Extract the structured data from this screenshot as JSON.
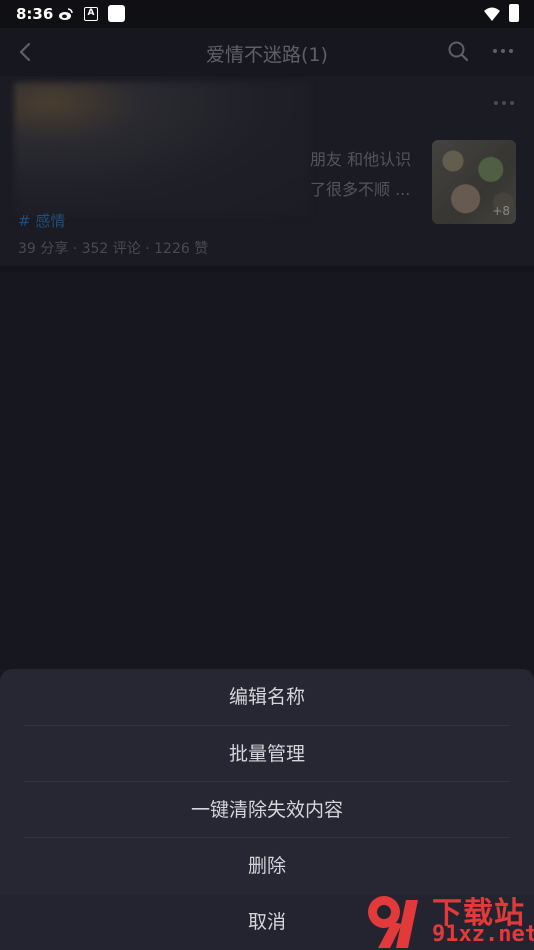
{
  "status_bar": {
    "time": "8:36",
    "app_icon_a": "A"
  },
  "header": {
    "title": "爱情不迷路(1)"
  },
  "card": {
    "text_line1": "朋友 和他认识",
    "text_line2": "了很多不顺 ...",
    "thumb_count": "+8",
    "topic": "# 感情",
    "meta": "39 分享 · 352 评论 · 1226 赞"
  },
  "sheet": {
    "items": [
      "编辑名称",
      "批量管理",
      "一键清除失效内容",
      "删除"
    ],
    "cancel": "取消"
  },
  "watermark": {
    "cn": "下载站",
    "en": "91xz.net"
  },
  "colors": {
    "background": "#17171f",
    "sheet": "#262733",
    "watermark": "#e23a3a",
    "topic": "#1f4f7a"
  }
}
